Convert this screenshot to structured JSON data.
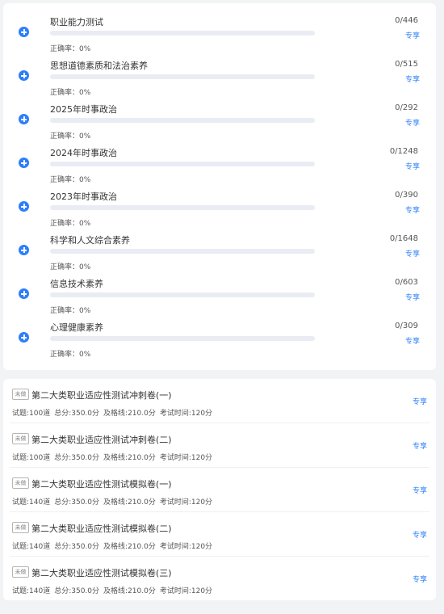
{
  "colors": {
    "accent": "#2d7ff9",
    "page_bg": "#f2f3f5",
    "card_bg": "#ffffff",
    "track": "#e9ecf3"
  },
  "practice": {
    "items": [
      {
        "icon": "plus-circle-icon",
        "title": "职业能力测试",
        "progress_label": "0/446",
        "progress_fraction": 0,
        "rate_label": "正确率：0%",
        "share_label": "专享"
      },
      {
        "icon": "plus-circle-icon",
        "title": "思想道德素质和法治素养",
        "progress_label": "0/515",
        "progress_fraction": 0,
        "rate_label": "正确率：0%",
        "share_label": "专享"
      },
      {
        "icon": "plus-circle-icon",
        "title": "2025年时事政治",
        "progress_label": "0/292",
        "progress_fraction": 0,
        "rate_label": "正确率：0%",
        "share_label": "专享"
      },
      {
        "icon": "plus-circle-icon",
        "title": "2024年时事政治",
        "progress_label": "0/1248",
        "progress_fraction": 0,
        "rate_label": "正确率：0%",
        "share_label": "专享"
      },
      {
        "icon": "plus-circle-icon",
        "title": "2023年时事政治",
        "progress_label": "0/390",
        "progress_fraction": 0,
        "rate_label": "正确率：0%",
        "share_label": "专享"
      },
      {
        "icon": "plus-circle-icon",
        "title": "科学和人文综合素养",
        "progress_label": "0/1648",
        "progress_fraction": 0,
        "rate_label": "正确率：0%",
        "share_label": "专享"
      },
      {
        "icon": "plus-circle-icon",
        "title": "信息技术素养",
        "progress_label": "0/603",
        "progress_fraction": 0,
        "rate_label": "正确率：0%",
        "share_label": "专享"
      },
      {
        "icon": "plus-circle-icon",
        "title": "心理健康素养",
        "progress_label": "0/309",
        "progress_fraction": 0,
        "rate_label": "正确率：0%",
        "share_label": "专享"
      }
    ]
  },
  "exams": {
    "items": [
      {
        "badge": "未做",
        "title": "第二大类职业适应性测试冲刺卷(一)",
        "questions": "试题:100道",
        "total": "总分:350.0分",
        "pass": "及格线:210.0分",
        "time": "考试时间:120分",
        "share_label": "专享"
      },
      {
        "badge": "未做",
        "title": "第二大类职业适应性测试冲刺卷(二)",
        "questions": "试题:100道",
        "total": "总分:350.0分",
        "pass": "及格线:210.0分",
        "time": "考试时间:120分",
        "share_label": "专享"
      },
      {
        "badge": "未做",
        "title": "第二大类职业适应性测试模拟卷(一)",
        "questions": "试题:140道",
        "total": "总分:350.0分",
        "pass": "及格线:210.0分",
        "time": "考试时间:120分",
        "share_label": "专享"
      },
      {
        "badge": "未做",
        "title": "第二大类职业适应性测试模拟卷(二)",
        "questions": "试题:140道",
        "total": "总分:350.0分",
        "pass": "及格线:210.0分",
        "time": "考试时间:120分",
        "share_label": "专享"
      },
      {
        "badge": "未做",
        "title": "第二大类职业适应性测试模拟卷(三)",
        "questions": "试题:140道",
        "total": "总分:350.0分",
        "pass": "及格线:210.0分",
        "time": "考试时间:120分",
        "share_label": "专享"
      }
    ]
  }
}
